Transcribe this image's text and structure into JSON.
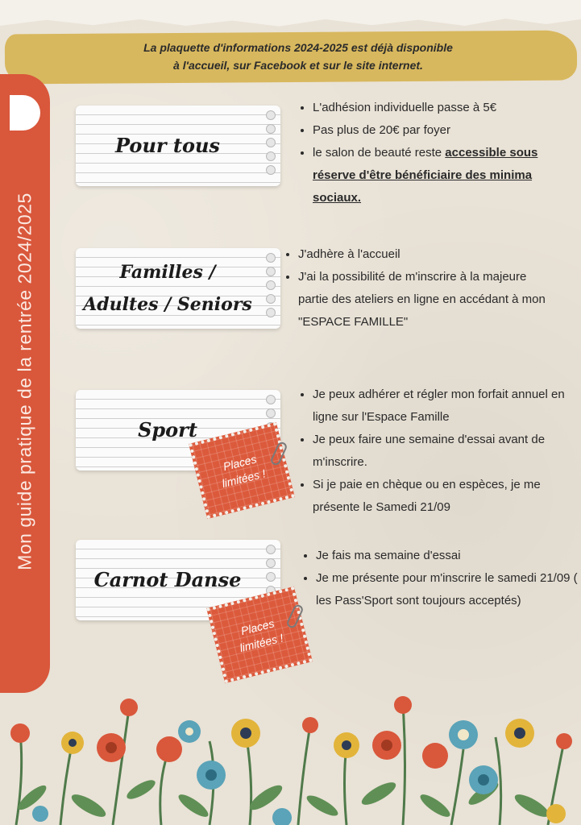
{
  "banner": {
    "line1": "La plaquette d'informations 2024-2025 est déjà disponible",
    "line2": "à l'accueil, sur Facebook et sur le site internet."
  },
  "side_title": "Mon guide pratique de la rentrée 2024/2025",
  "sections": [
    {
      "title": "Pour tous",
      "bullets": [
        "L'adhésion individuelle passe à 5€",
        "Pas plus de 20€ par foyer",
        "le salon de beauté reste"
      ],
      "bullet3_emphasis": "accessible sous réserve d'être bénéficiaire des minima sociaux."
    },
    {
      "title_line1": "Familles /",
      "title_line2": "Adultes / Seniors",
      "bullets": [
        "J'adhère à l'accueil",
        "J'ai la possibilité de m'inscrire à la majeure partie des ateliers en ligne en accédant à mon \"ESPACE FAMILLE\""
      ]
    },
    {
      "title": "Sport",
      "bullets": [
        "Je peux adhérer et régler mon forfait annuel en ligne sur l'Espace Famille",
        "Je peux faire une semaine d'essai avant de m'inscrire.",
        "Si je paie en chèque ou en espèces, je me présente le Samedi 21/09"
      ],
      "stamp_line1": "Places",
      "stamp_line2": "limitées !"
    },
    {
      "title": "Carnot Danse",
      "bullets": [
        "Je fais ma semaine d'essai",
        "Je me présente pour m'inscrire le samedi 21/09 ( les Pass'Sport sont toujours acceptés)"
      ],
      "stamp_line1": "Places",
      "stamp_line2": "limitées !"
    }
  ],
  "colors": {
    "background": "#e9e2d6",
    "accent_red": "#d9573b",
    "banner_yellow": "#d8b85e"
  }
}
